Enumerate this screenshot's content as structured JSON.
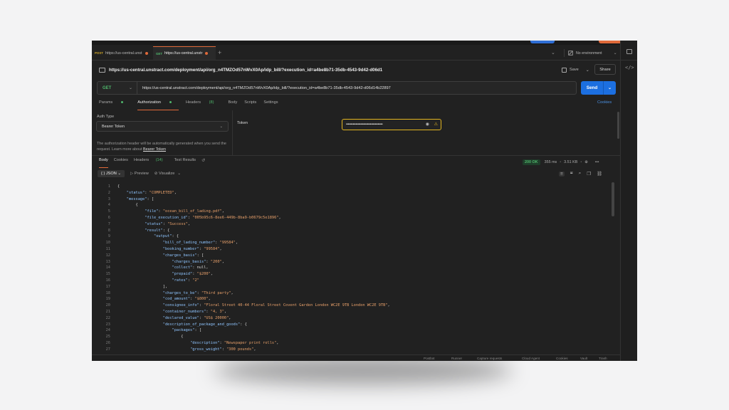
{
  "tabs": [
    {
      "method": "POST",
      "label": "https://us-central.unst",
      "active": false
    },
    {
      "method": "GET",
      "label": "https://us-central.unstr",
      "active": true
    }
  ],
  "env": {
    "label": "No environment"
  },
  "request": {
    "title": "https://us-central.unstract.com/deployment/api/org_n4TMZOd57nWvX0Ap/idp_bill/?execution_id=a4be8b71-35db-4543-9d42-d06d1",
    "save_label": "Save",
    "share_label": "Share",
    "method": "GET",
    "url": "https://us-central.unstract.com/deployment/api/org_n4TMZOd57nWvX0Ap/idp_bill/?execution_id=a4be8b71-35db-4543-9d42-d06d14b22897",
    "send_label": "Send"
  },
  "req_tabs": {
    "params": "Params",
    "authorization": "Authorization",
    "headers": "Headers",
    "headers_count": "(8)",
    "body": "Body",
    "scripts": "Scripts",
    "settings": "Settings",
    "cookies": "Cookies"
  },
  "auth": {
    "type_label": "Auth Type",
    "type_value": "Bearer Token",
    "info": "The authorization header will be automatically generated when you send the request. Learn more about",
    "info_link": "Bearer Token",
    "token_label": "Token",
    "token_value": "••••••••••••••••••••••••••••••••••••••"
  },
  "response": {
    "tabs": {
      "body": "Body",
      "cookies": "Cookies",
      "headers": "Headers",
      "headers_count": "(14)",
      "test_results": "Test Results"
    },
    "status": "200 OK",
    "time": "355 ms",
    "size": "3.51 KB",
    "format": "JSON",
    "preview": "Preview",
    "visualize": "Visualize"
  },
  "code_lines": [
    {
      "n": "1",
      "html": "{"
    },
    {
      "n": "2",
      "html": "    <span class=\"k\">\"status\"</span>: <span class=\"s\">\"COMPLETED\"</span>,"
    },
    {
      "n": "3",
      "html": "    <span class=\"k\">\"message\"</span>: ["
    },
    {
      "n": "4",
      "html": "        {"
    },
    {
      "n": "5",
      "html": "            <span class=\"k\">\"file\"</span>: <span class=\"s\">\"ocean_bill_of_lading.pdf\"</span>,"
    },
    {
      "n": "6",
      "html": "            <span class=\"k\">\"file_execution_id\"</span>: <span class=\"s\">\"005b95c6-8ee6-449b-8ba9-b0679c5e1896\"</span>,"
    },
    {
      "n": "7",
      "html": "            <span class=\"k\">\"status\"</span>: <span class=\"s\">\"Success\"</span>,"
    },
    {
      "n": "8",
      "html": "            <span class=\"k\">\"result\"</span>: {"
    },
    {
      "n": "9",
      "html": "                <span class=\"k\">\"output\"</span>: {"
    },
    {
      "n": "10",
      "html": "                    <span class=\"k\">\"bill_of_lading_number\"</span>: <span class=\"s\">\"99584\"</span>,"
    },
    {
      "n": "11",
      "html": "                    <span class=\"k\">\"booking_number\"</span>: <span class=\"s\">\"99584\"</span>,"
    },
    {
      "n": "12",
      "html": "                    <span class=\"k\">\"charges_basis\"</span>: ["
    },
    {
      "n": "13",
      "html": "                        <span class=\"k\">\"charges_basis\"</span>: <span class=\"s\">\"200\"</span>,"
    },
    {
      "n": "14",
      "html": "                        <span class=\"k\">\"collect\"</span>: null,"
    },
    {
      "n": "15",
      "html": "                        <span class=\"k\">\"prepaid\"</span>: <span class=\"s\">\"$200\"</span>,"
    },
    {
      "n": "16",
      "html": "                        <span class=\"k\">\"rates\"</span>: <span class=\"s\">\"2\"</span>"
    },
    {
      "n": "17",
      "html": "                    ],"
    },
    {
      "n": "18",
      "html": "                    <span class=\"k\">\"charges_to_be\"</span>: <span class=\"s\">\"Third party\"</span>,"
    },
    {
      "n": "19",
      "html": "                    <span class=\"k\">\"cod_amount\"</span>: <span class=\"s\">\"$800\"</span>,"
    },
    {
      "n": "20",
      "html": "                    <span class=\"k\">\"consignee_info\"</span>: <span class=\"s\">\"Floral Street 40-44 Floral Street Covent Garden London WC2E 9TB London WC2E 9TB\"</span>,"
    },
    {
      "n": "21",
      "html": "                    <span class=\"k\">\"container_numbers\"</span>: <span class=\"s\">\"4, 3\"</span>,"
    },
    {
      "n": "22",
      "html": "                    <span class=\"k\">\"declared_value\"</span>: <span class=\"s\">\"US$ 20000\"</span>,"
    },
    {
      "n": "23",
      "html": "                    <span class=\"k\">\"description_of_package_and_goods\"</span>: {"
    },
    {
      "n": "24",
      "html": "                        <span class=\"k\">\"packages\"</span>: ["
    },
    {
      "n": "25",
      "html": "                            {"
    },
    {
      "n": "26",
      "html": "                                <span class=\"k\">\"description\"</span>: <span class=\"s\">\"Newspaper print rolls\"</span>,"
    },
    {
      "n": "27",
      "html": "                                <span class=\"k\">\"gross_weight\"</span>: <span class=\"s\">\"300 pounds\"</span>,"
    }
  ],
  "footer": {
    "postbot": "Postbot",
    "runner": "Runner",
    "capture": "Capture requests",
    "cloud": "Cloud Agent",
    "cookies": "Cookies",
    "vault": "Vault",
    "trash": "Trash"
  },
  "colors": {
    "accent": "#e06a3a",
    "send": "#1c6fe0",
    "get": "#4fb56b",
    "token_border": "#e3b520"
  }
}
